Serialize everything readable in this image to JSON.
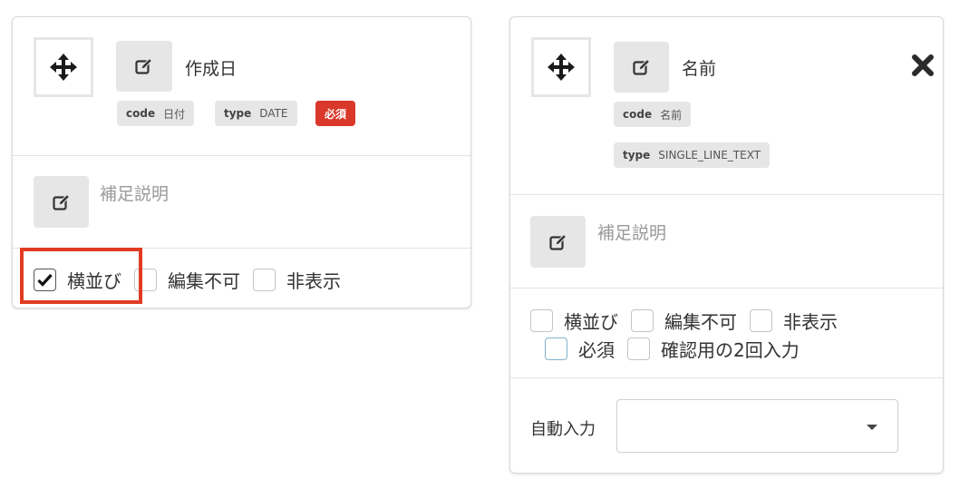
{
  "left_card": {
    "title": "作成日",
    "code_key": "code",
    "code_value": "日付",
    "type_key": "type",
    "type_value": "DATE",
    "required_badge": "必須",
    "description_placeholder": "補足説明",
    "options": [
      {
        "label": "横並び",
        "checked": true
      },
      {
        "label": "編集不可",
        "checked": false
      },
      {
        "label": "非表示",
        "checked": false
      }
    ]
  },
  "right_card": {
    "title": "名前",
    "code_key": "code",
    "code_value": "名前",
    "type_key": "type",
    "type_value": "SINGLE_LINE_TEXT",
    "description_placeholder": "補足説明",
    "options_row1": [
      {
        "label": "横並び",
        "checked": false
      },
      {
        "label": "編集不可",
        "checked": false
      },
      {
        "label": "非表示",
        "checked": false
      }
    ],
    "options_row2": [
      {
        "label": "必須",
        "checked": false
      },
      {
        "label": "確認用の2回入力",
        "checked": false
      }
    ],
    "auto_input_label": "自動入力",
    "auto_input_value": ""
  },
  "colors": {
    "highlight": "#e23b22",
    "required_badge": "#d9382a",
    "button_bg": "#e6e6e6"
  },
  "icons": {
    "move": "move-arrows-icon",
    "edit": "edit-icon",
    "close": "close-x-icon",
    "caret": "caret-down-icon"
  }
}
